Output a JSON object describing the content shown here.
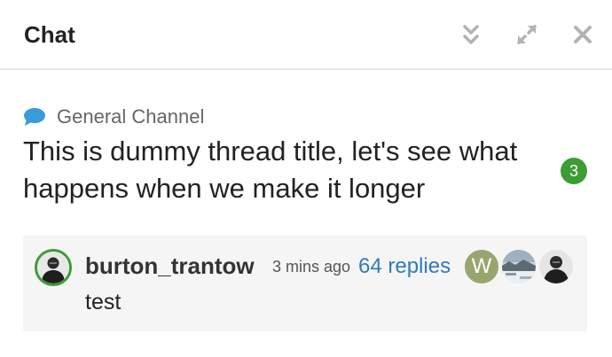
{
  "header": {
    "title": "Chat"
  },
  "thread": {
    "channel_name": "General Channel",
    "title": "This is dummy thread title, let's see what happens when we make it longer",
    "unread_count": "3"
  },
  "post": {
    "username": "burton_trantow",
    "time": "3 mins ago",
    "replies": "64 replies",
    "text": "test",
    "participant_initial": "W"
  },
  "colors": {
    "accent_green": "#3e9c35",
    "link_blue": "#2e7bbd",
    "channel_icon_blue": "#3b9ad9",
    "participant_w": "#97a56e"
  },
  "icons": {
    "minimize": "double-chevron-down-icon",
    "expand": "expand-arrows-icon",
    "close": "close-icon",
    "channel": "speech-bubble-icon"
  }
}
